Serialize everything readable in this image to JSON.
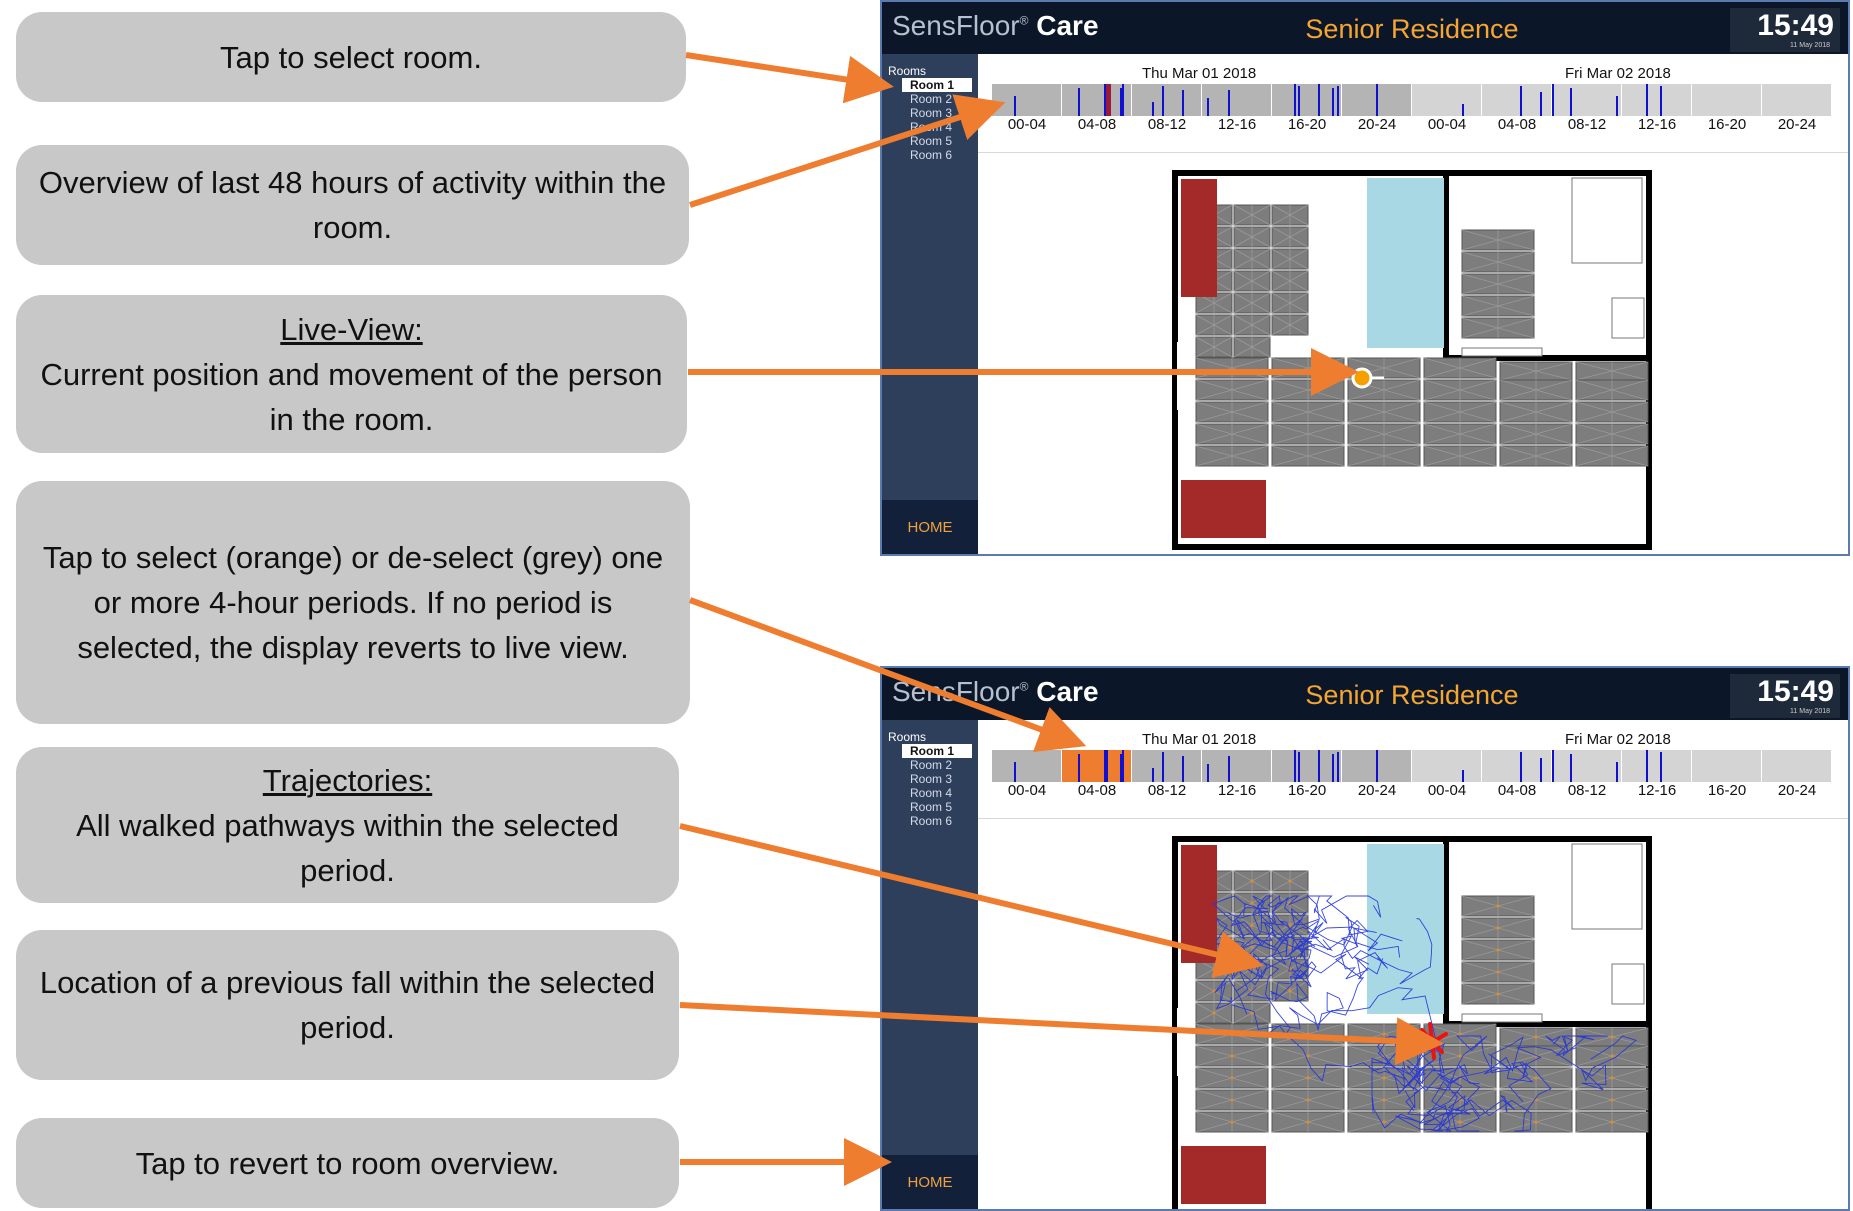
{
  "callouts": [
    {
      "heading": "",
      "text": "Tap to select room."
    },
    {
      "heading": "",
      "text": "Overview of last 48 hours of activity within the room."
    },
    {
      "heading": "Live-View:",
      "text": "Current position and movement of the person in the room."
    },
    {
      "heading": "",
      "text": "Tap to select (orange) or de-select (grey) one or more 4-hour periods. If no period is selected, the display reverts to live view."
    },
    {
      "heading": "Trajectories:",
      "text": "All walked pathways within the selected period."
    },
    {
      "heading": "",
      "text": "Location of a previous fall within the selected period."
    },
    {
      "heading": "",
      "text": "Tap to revert to room overview."
    }
  ],
  "screen": {
    "brand_prefix": "SensFloor",
    "brand_reg": "®",
    "brand_suffix": "Care",
    "facility": "Senior Residence",
    "time": "15:49",
    "date_small": "11 May 2018",
    "rooms_label": "Rooms",
    "rooms": [
      "Room 1",
      "Room 2",
      "Room 3",
      "Room 4",
      "Room 5",
      "Room 6"
    ],
    "selected_room": "Room 1",
    "home_label": "HOME",
    "dates": [
      "Thu Mar 01 2018",
      "Fri Mar 02 2018"
    ],
    "periods": [
      "00-04",
      "04-08",
      "08-12",
      "12-16",
      "16-20",
      "20-24",
      "00-04",
      "04-08",
      "08-12",
      "12-16",
      "16-20",
      "20-24"
    ]
  },
  "views": [
    {
      "name": "live-view",
      "selected_periods": [],
      "shows_current_position": true,
      "shows_trajectories": false,
      "shows_fall": false
    },
    {
      "name": "history-view",
      "selected_periods": [
        1
      ],
      "shows_current_position": false,
      "shows_trajectories": true,
      "shows_fall": true
    }
  ],
  "colors": {
    "callout_bg": "#c8c8c8",
    "arrow": "#ee7d30",
    "topbar": "#0b1729",
    "sidebar": "#2e3f5b",
    "facility_text": "#f5a532",
    "period_unselected_day1": "#b4b4b4",
    "period_unselected_day2": "#d4d4d4",
    "period_selected": "#ee7d30",
    "activity_spike": "#1010d0",
    "bed": "#a42a2a",
    "bathroom": "#a8d8e4",
    "floor_tile": "#7d7d7d",
    "trajectory": "#2233dd",
    "fall_marker": "#ee1111",
    "position_marker": "#f5a000"
  }
}
